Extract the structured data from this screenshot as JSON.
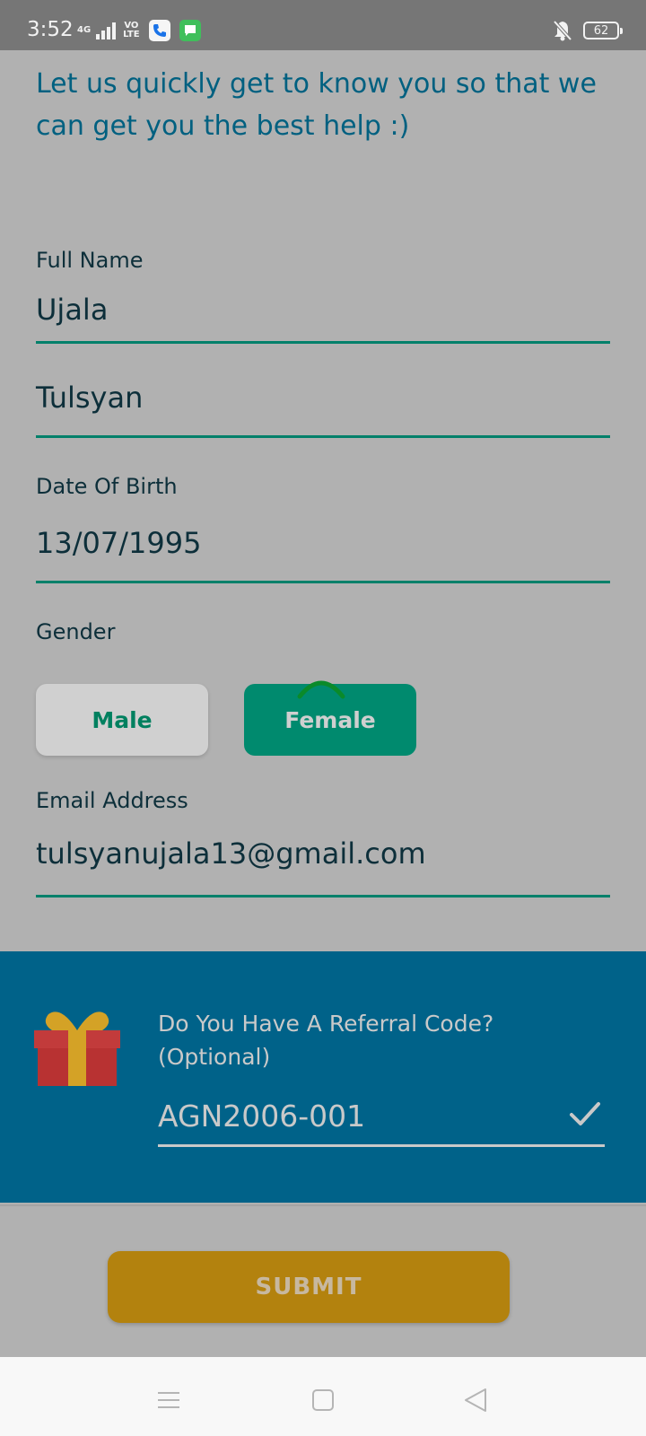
{
  "status_bar": {
    "time": "3:52",
    "network": "4G",
    "volte_line1": "VO",
    "volte_line2": "LTE",
    "battery": "62"
  },
  "intro_text": "Let us quickly get to know you so that we can get you the best help :)",
  "form": {
    "full_name_label": "Full Name",
    "first_name": "Ujala",
    "last_name": "Tulsyan",
    "dob_label": "Date Of Birth",
    "dob_value": "13/07/1995",
    "gender_label": "Gender",
    "gender_options": [
      "Male",
      "Female"
    ],
    "gender_selected": "Female",
    "email_label": "Email Address",
    "email_value": "tulsyanujala13@gmail.com"
  },
  "referral": {
    "title_line1": "Do You Have A Referral Code?",
    "title_line2": "(Optional)",
    "code": "AGN2006-001"
  },
  "submit_label": "SUBMIT",
  "colors": {
    "accent_green": "#008a6e",
    "referral_bg": "#006289",
    "submit_bg": "#b3820e",
    "intro_text": "#006080"
  }
}
